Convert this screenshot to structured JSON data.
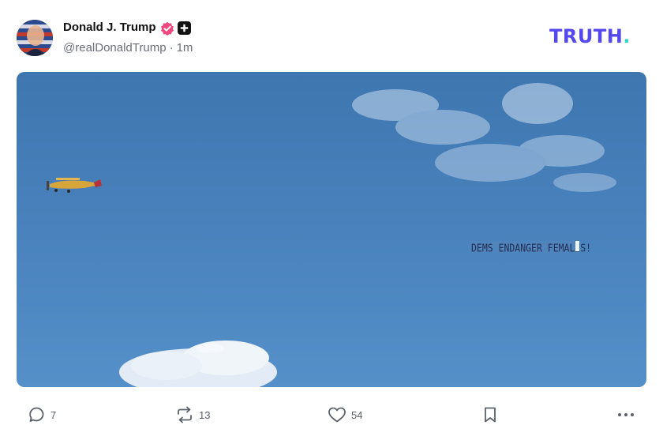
{
  "post": {
    "author_name": "Donald J. Trump",
    "handle": "@realDonaldTrump",
    "separator": "·",
    "time": "1m",
    "badges": [
      "verified-badge-icon",
      "plus-badge-icon"
    ]
  },
  "brand": {
    "logo_text": "TRUTH",
    "logo_dot": ".",
    "color": "#5448ee",
    "dot_color": "#2fd5c5"
  },
  "media": {
    "banner_text": "DEMS ENDANGER FEMALES!"
  },
  "actions": {
    "reply_count": "7",
    "retruth_count": "13",
    "like_count": "54"
  },
  "icons": {
    "reply": "speech-bubble-icon",
    "retruth": "repost-arrows-icon",
    "like": "heart-icon",
    "bookmark": "bookmark-icon",
    "more": "more-dots-icon"
  },
  "colors": {
    "verified": "#f2477e",
    "sky": "#4a83bd",
    "text_secondary": "#6a6f78"
  }
}
